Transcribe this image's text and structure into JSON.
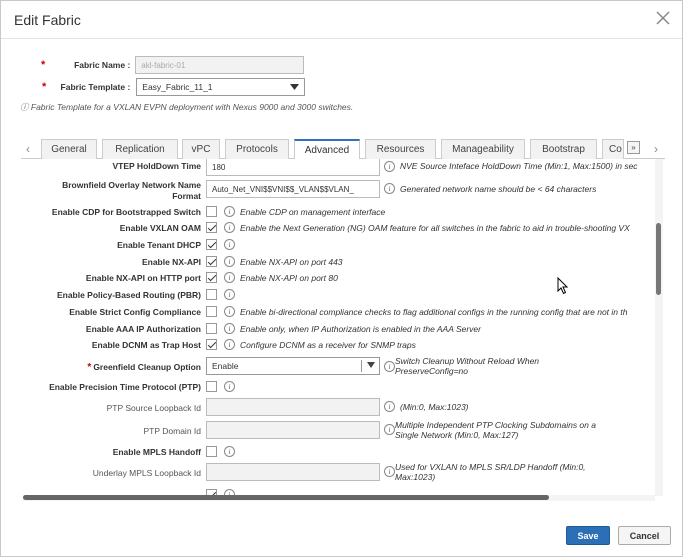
{
  "dialog": {
    "title": "Edit Fabric",
    "fabric_name_label": "Fabric Name :",
    "fabric_name_value": "akl-fabric-01",
    "fabric_template_label": "Fabric Template :",
    "fabric_template_value": "Easy_Fabric_11_1",
    "template_note": "Fabric Template for a VXLAN EVPN deployment with Nexus 9000 and 3000 switches."
  },
  "tabs": {
    "items": [
      "General",
      "Replication",
      "vPC",
      "Protocols",
      "Advanced",
      "Resources",
      "Manageability",
      "Bootstrap",
      "Co"
    ],
    "active": "Advanced",
    "more": "»"
  },
  "rows": {
    "vtep_label": "VTEP HoldDown Time",
    "vtep_value": "180",
    "vtep_desc": "NVE Source Inteface HoldDown Time (Min:1, Max:1500) in sec",
    "brownfield_label_1": "Brownfield Overlay Network Name",
    "brownfield_label_2": "Format",
    "brownfield_value": "Auto_Net_VNI$$VNI$$_VLAN$$VLAN_",
    "brownfield_desc": "Generated network name should be < 64 characters",
    "cdp_label": "Enable CDP for Bootstrapped Switch",
    "cdp_desc": "Enable CDP on management interface",
    "oam_label": "Enable VXLAN OAM",
    "oam_desc": "Enable the Next Generation (NG) OAM feature for all switches in the fabric to aid in trouble-shooting VX",
    "dhcp_label": "Enable Tenant DHCP",
    "nxapi_label": "Enable NX-API",
    "nxapi_desc": "Enable NX-API on port 443",
    "nxapi_http_label": "Enable NX-API on HTTP port",
    "nxapi_http_desc": "Enable NX-API on port 80",
    "pbr_label": "Enable Policy-Based Routing (PBR)",
    "strict_label": "Enable Strict Config Compliance",
    "strict_desc": "Enable bi-directional compliance checks to flag additional configs in the running config that are not in th",
    "aaa_label": "Enable AAA IP Authorization",
    "aaa_desc": "Enable only, when IP Authorization is enabled in the AAA Server",
    "trap_label": "Enable DCNM as Trap Host",
    "trap_desc": "Configure DCNM as a receiver for SNMP traps",
    "greenfield_label": "Greenfield Cleanup Option",
    "greenfield_value": "Enable",
    "greenfield_desc": "Switch Cleanup Without Reload When PreserveConfig=no",
    "ptp_label": "Enable Precision Time Protocol (PTP)",
    "ptp_loopback_label": "PTP Source Loopback Id",
    "ptp_loopback_desc": "(Min:0, Max:1023)",
    "ptp_domain_label": "PTP Domain Id",
    "ptp_domain_desc": "Multiple Independent PTP Clocking Subdomains on a Single Network (Min:0, Max:127)",
    "mpls_label": "Enable MPLS Handoff",
    "underlay_label": "Underlay MPLS Loopback Id",
    "underlay_desc": "Used for VXLAN to MPLS SR/LDP Handoff (Min:0, Max:1023)"
  },
  "buttons": {
    "save": "Save",
    "cancel": "Cancel"
  },
  "colors": {
    "accent": "#2b6fb6",
    "required": "#cc0000"
  }
}
